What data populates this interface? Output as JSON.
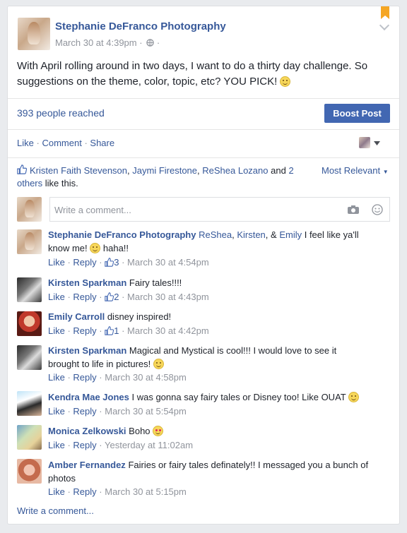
{
  "post": {
    "author": "Stephanie DeFranco Photography",
    "timestamp": "March 30 at 4:39pm",
    "privacy_sep": "·",
    "body_line1": "With April rolling around in two days, I want to do a thirty day challenge. So",
    "body_line2": "suggestions on the theme, color, topic, etc? YOU PICK!",
    "reach": "393 people reached",
    "boost_label": "Boost Post"
  },
  "actions": {
    "like": "Like",
    "comment": "Comment",
    "share": "Share",
    "dot": "·"
  },
  "likes": {
    "names_1": "Kristen Faith Stevenson",
    "names_2": "Jaymi Firestone",
    "names_3": "ReShea Lozano",
    "and": "and",
    "others_a": "2",
    "others_b": "others",
    "suffix": "like this.",
    "sort_label": "Most Relevant"
  },
  "composer": {
    "placeholder": "Write a comment..."
  },
  "comments": [
    {
      "author": "Stephanie DeFranco Photography",
      "tag1": "ReShea",
      "tag2": "Kirsten",
      "tag3": "Emily",
      "text_a": "I feel like ya'll",
      "text_b": "know me!",
      "text_c": "haha!!",
      "like": "Like",
      "reply": "Reply",
      "likes": "3",
      "time": "March 30 at 4:54pm"
    },
    {
      "author": "Kirsten Sparkman",
      "text": "Fairy tales!!!!",
      "like": "Like",
      "reply": "Reply",
      "likes": "2",
      "time": "March 30 at 4:43pm"
    },
    {
      "author": "Emily Carroll",
      "text": "disney inspired!",
      "like": "Like",
      "reply": "Reply",
      "likes": "1",
      "time": "March 30 at 4:42pm"
    },
    {
      "author": "Kirsten Sparkman",
      "text_a": "Magical and Mystical is cool!!! I would love to see it",
      "text_b": "brought to life in pictures!",
      "like": "Like",
      "reply": "Reply",
      "time": "March 30 at 4:58pm"
    },
    {
      "author": "Kendra Mae Jones",
      "text": "I was gonna say fairy tales or Disney too! Like OUAT",
      "like": "Like",
      "reply": "Reply",
      "time": "March 30 at 5:54pm"
    },
    {
      "author": "Monica Zelkowski",
      "text": "Boho",
      "like": "Like",
      "reply": "Reply",
      "time": "Yesterday at 11:02am"
    },
    {
      "author": "Amber Fernandez",
      "text_a": "Fairies or fairy tales definately!! I messaged you a bunch of",
      "text_b": "photos",
      "like": "Like",
      "reply": "Reply",
      "time": "March 30 at 5:15pm"
    }
  ],
  "footer": {
    "write_comment": "Write a comment..."
  },
  "colors": {
    "link": "#365899",
    "boost": "#4267b2",
    "muted": "#90949c",
    "bookmark": "#f5a623"
  }
}
